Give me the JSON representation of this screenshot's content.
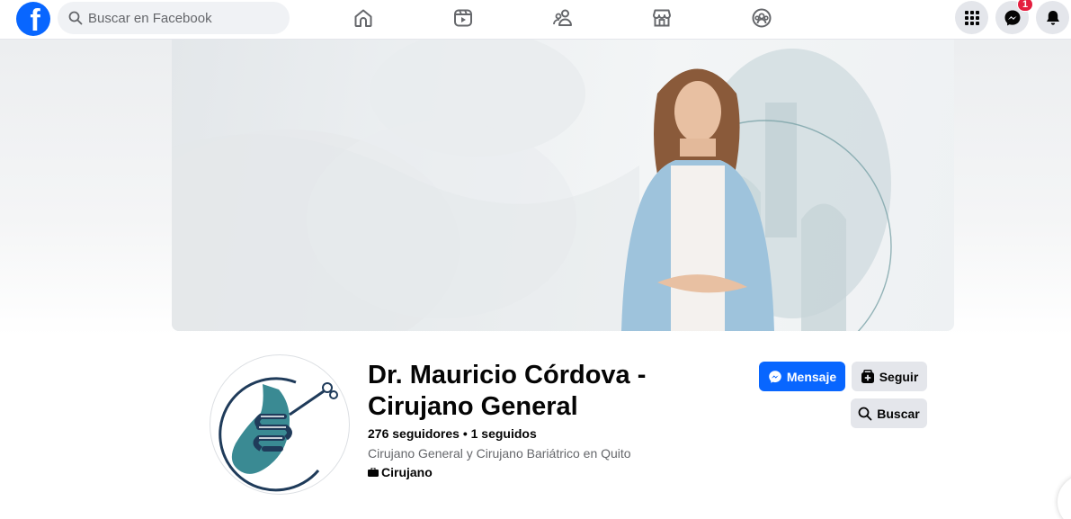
{
  "topbar": {
    "logo_letter": "f",
    "search_placeholder": "Buscar en Facebook",
    "nav_icons": [
      "home-icon",
      "video-icon",
      "friends-icon",
      "marketplace-icon",
      "groups-icon"
    ],
    "right_icons": [
      "menu-grid-icon",
      "messenger-icon",
      "notifications-icon"
    ],
    "messenger_badge": "1"
  },
  "colors": {
    "brand": "#0866ff",
    "badge": "#e41e3f",
    "secondary_button": "#e4e6eb",
    "logo_teal": "#3a8a93",
    "logo_navy": "#1f3b5a"
  },
  "profile": {
    "name": "Dr. Mauricio Córdova - Cirujano General",
    "stats": "276 seguidores • 1 seguidos",
    "bio": "Cirujano General y Cirujano Bariátrico en Quito",
    "category": "Cirujano",
    "category_icon": "briefcase-icon"
  },
  "actions": {
    "message_label": "Mensaje",
    "follow_label": "Seguir",
    "search_label": "Buscar"
  }
}
